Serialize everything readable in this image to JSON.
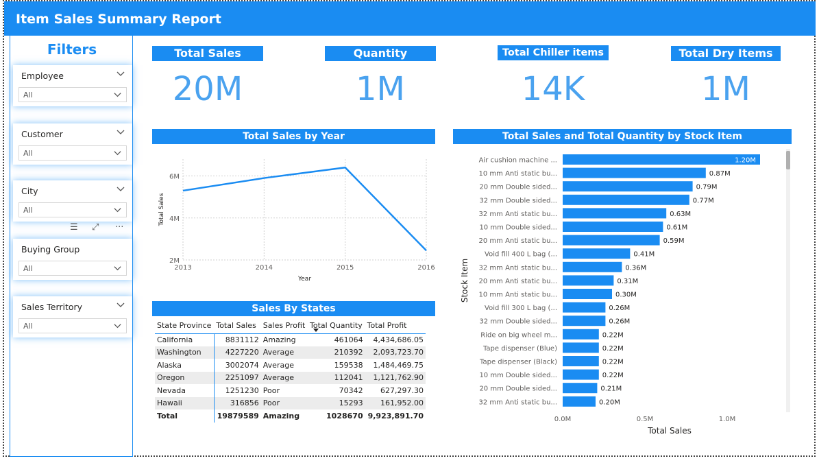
{
  "header": {
    "title": "Item Sales Summary Report"
  },
  "filters": {
    "title": "Filters",
    "slicers": [
      {
        "label": "Employee",
        "value": "All"
      },
      {
        "label": "Customer",
        "value": "All"
      },
      {
        "label": "City",
        "value": "All"
      },
      {
        "label": "Buying Group",
        "value": "All"
      },
      {
        "label": "Sales Territory",
        "value": "All"
      }
    ]
  },
  "kpis": [
    {
      "label": "Total Sales",
      "value": "20M"
    },
    {
      "label": "Quantity",
      "value": "1M"
    },
    {
      "label": "Total Chiller items",
      "value": "14K"
    },
    {
      "label": "Total Dry Items",
      "value": "1M"
    }
  ],
  "accent": "#1a8cf2",
  "chart_data": [
    {
      "type": "line",
      "title": "Total Sales by Year",
      "xlabel": "Year",
      "ylabel": "Total Sales",
      "x": [
        2013,
        2014,
        2015,
        2016
      ],
      "x_ticks": [
        "2013",
        "2014",
        "2015",
        "2016"
      ],
      "y_ticks": [
        "2M",
        "4M",
        "6M"
      ],
      "ylim": [
        2000000,
        6800000
      ],
      "series": [
        {
          "values": [
            5300000,
            5900000,
            6400000,
            2450000
          ]
        }
      ],
      "grid": true
    },
    {
      "type": "bar",
      "orientation": "horizontal",
      "title": "Total Sales and Total Quantity by Stock Item",
      "xlabel": "Total Sales",
      "ylabel": "Stock Item",
      "x_ticks": [
        "0.0M",
        "0.5M",
        "1.0M"
      ],
      "xlim": [
        0,
        1300000
      ],
      "categories": [
        "Air cushion machine ...",
        "10 mm Anti static bu...",
        "20 mm Double sided...",
        "32 mm Double sided...",
        "32 mm Anti static bu...",
        "10 mm Double sided...",
        "20 mm Anti static bu...",
        "Void fill 400 L bag (...",
        "32 mm Anti static bu...",
        "20 mm Anti static bu...",
        "10 mm Anti static bu...",
        "Void fill 300 L bag (...",
        "32 mm Double sided...",
        "Ride on big wheel m...",
        "Tape dispenser (Blue)",
        "Tape dispenser (Black)",
        "10 mm Double sided...",
        "20 mm Double sided...",
        "32 mm Anti static bu..."
      ],
      "values": [
        1200000,
        870000,
        790000,
        770000,
        630000,
        610000,
        590000,
        410000,
        360000,
        310000,
        300000,
        260000,
        260000,
        220000,
        220000,
        220000,
        220000,
        210000,
        200000
      ],
      "labels": [
        "1.20M",
        "0.87M",
        "0.79M",
        "0.77M",
        "0.63M",
        "0.61M",
        "0.59M",
        "0.41M",
        "0.36M",
        "0.31M",
        "0.30M",
        "0.26M",
        "0.26M",
        "0.22M",
        "0.22M",
        "0.22M",
        "0.22M",
        "0.21M",
        "0.20M"
      ]
    }
  ],
  "states_table": {
    "title": "Sales By States",
    "columns": [
      "State Province",
      "Total Sales",
      "Sales Profit",
      "Total Quantity",
      "Total Profit"
    ],
    "rows": [
      [
        "California",
        "8831112",
        "Amazing",
        "461064",
        "4,434,686.05"
      ],
      [
        "Washington",
        "4227220",
        "Average",
        "210392",
        "2,093,723.70"
      ],
      [
        "Alaska",
        "3002074",
        "Average",
        "159538",
        "1,484,469.75"
      ],
      [
        "Oregon",
        "2251097",
        "Average",
        "112041",
        "1,121,762.90"
      ],
      [
        "Nevada",
        "1251230",
        "Poor",
        "70342",
        "627,297.30"
      ],
      [
        "Hawaii",
        "316856",
        "Poor",
        "15293",
        "161,952.00"
      ]
    ],
    "total": [
      "Total",
      "19879589",
      "Amazing",
      "1028670",
      "9,923,891.70"
    ]
  }
}
